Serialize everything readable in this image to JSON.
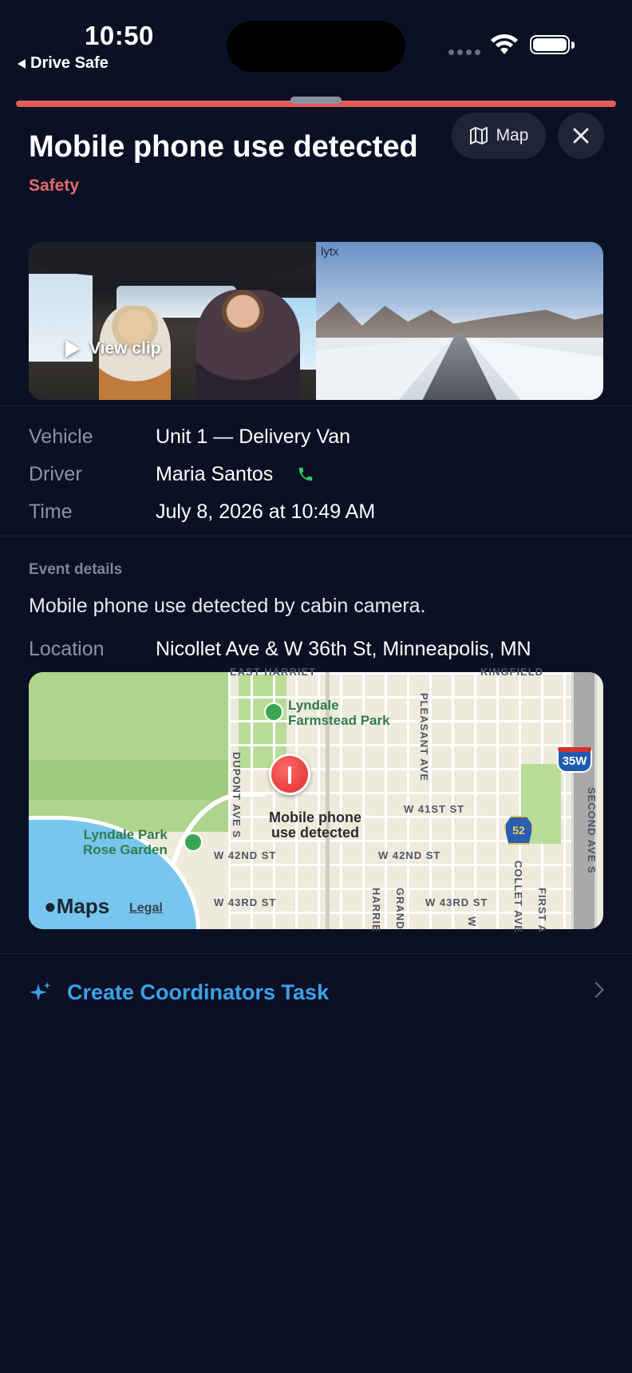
{
  "status_bar": {
    "time": "10:50",
    "back_app": "Drive Safe"
  },
  "header": {
    "title": "Mobile phone use detected",
    "category": "Safety",
    "map_button_label": "Map",
    "accent_color": "#e25c5c"
  },
  "video": {
    "watermark": "lytx",
    "play_label": "View clip"
  },
  "details": [
    {
      "label": "Vehicle",
      "value": "Unit 1 — Delivery Van"
    },
    {
      "label": "Driver",
      "value": "Maria Santos"
    },
    {
      "label": "Time",
      "value": "July 8, 2026 at 10:49 AM"
    }
  ],
  "event": {
    "section_title": "Event details",
    "description": "Mobile phone use detected by cabin camera.",
    "location_label": "Location",
    "location_value": "Nicollet Ave & W 36th St, Minneapolis, MN"
  },
  "map": {
    "pin_label_line1": "Mobile phone",
    "pin_label_line2": "use detected",
    "park1_line1": "Lyndale",
    "park1_line2": "Farmstead Park",
    "park2_line1": "Lyndale Park",
    "park2_line2": "Rose Garden",
    "streets": {
      "east_harriet": "EAST HARRIET",
      "kingfield": "KINGFIELD",
      "pleasant": "PLEASANT AVE",
      "dupont": "DUPONT AVE S",
      "second": "SECOND AVE S",
      "w41": "W 41ST ST",
      "w42a": "W 42ND ST",
      "w42b": "W 42ND ST",
      "w43a": "W 43RD ST",
      "w43b": "W 43RD ST",
      "harriet": "HARRIE",
      "grand": "GRAND",
      "nicollet": "COLLET AVE",
      "first": "FIRST A",
      "w": "W"
    },
    "shield_35w": "35W",
    "shield_52": "52",
    "brand": "Maps",
    "legal": "Legal"
  },
  "action": {
    "label": "Create Coordinators Task",
    "color": "#3ea0e8"
  }
}
